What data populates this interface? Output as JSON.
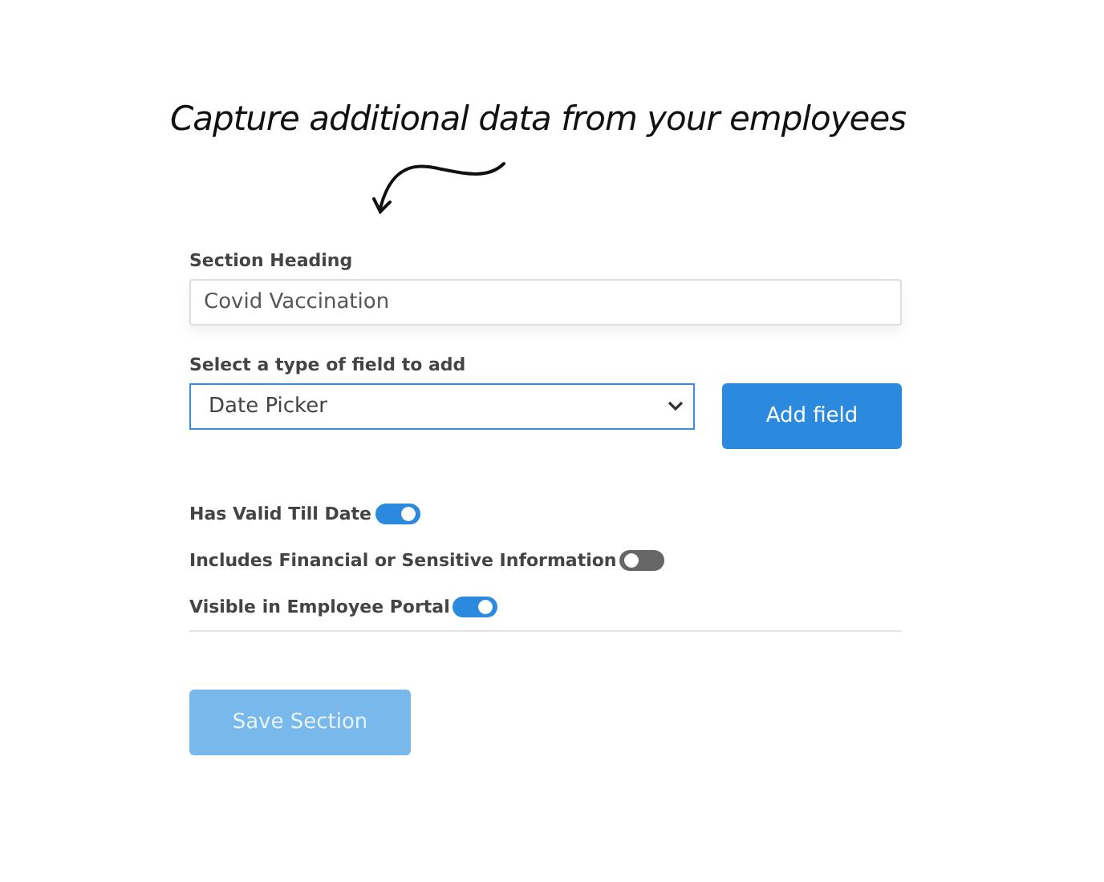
{
  "caption": "Capture additional data from your employees",
  "section_heading": {
    "label": "Section Heading",
    "value": "Covid Vaccination"
  },
  "field_type": {
    "label": "Select a type of field to add",
    "value": "Date Picker"
  },
  "add_button": "Add field",
  "toggles": [
    {
      "label": "Has Valid Till Date",
      "on": true
    },
    {
      "label": "Includes Financial or Sensitive Information",
      "on": false
    },
    {
      "label": "Visible in Employee Portal",
      "on": true
    }
  ],
  "save_button": {
    "label": "Save Section",
    "disabled": true
  }
}
